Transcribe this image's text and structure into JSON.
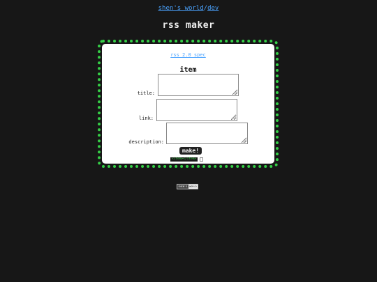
{
  "header": {
    "crumb_home": "shen's world",
    "crumb_separator": "/",
    "crumb_dev": "dev",
    "title": "rss maker",
    "link_color": "#4aa3ff"
  },
  "card": {
    "border_color": "#35d047",
    "spec_link": "rss 2.0 spec",
    "section_title": "item",
    "fields": {
      "title": {
        "label": "title:",
        "value": "",
        "placeholder": ""
      },
      "link": {
        "label": "link:",
        "value": "",
        "placeholder": ""
      },
      "description": {
        "label": "description:",
        "value": "",
        "placeholder": ""
      }
    },
    "make_button": "make!",
    "output": "<item></item>",
    "copy_icon": "copy-checkbox-icon"
  },
  "footer": {
    "badge_left": "SHEN'S",
    "badge_right": "WORLD"
  }
}
